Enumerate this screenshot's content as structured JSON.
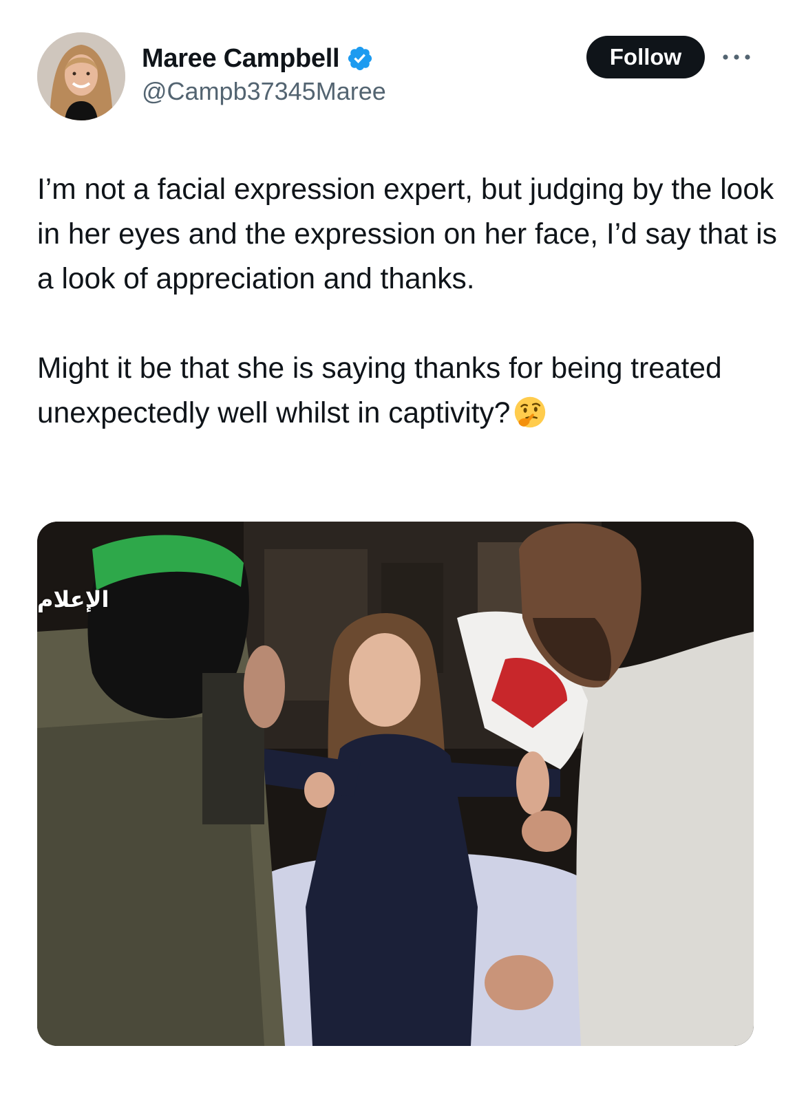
{
  "author": {
    "display_name": "Maree Campbell",
    "handle": "@Campb37345Maree",
    "verified": true
  },
  "actions": {
    "follow_label": "Follow",
    "more_icon": "more-horizontal-icon"
  },
  "tweet": {
    "paragraphs": [
      "I’m not a facial expression expert, but judging by the look in her eyes and the expression on her face, I’d say that is a look of appreciation and thanks.",
      "Might it be that she is saying thanks for being treated unexpectedly well whilst in captivity?"
    ],
    "emoji": "thinking-face-icon"
  },
  "media": {
    "watermark_text": "الإعلام"
  },
  "colors": {
    "follow_bg": "#0f1419",
    "verified_blue": "#1d9bf0",
    "secondary_text": "#536471"
  }
}
